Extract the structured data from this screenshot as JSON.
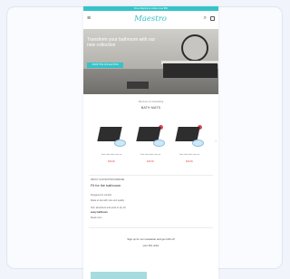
{
  "topbar": {
    "text": "Free shipping on orders over $50"
  },
  "header": {
    "brand": "Maestro",
    "menu_icon": "menu-icon",
    "search_icon": "search-icon",
    "cart_icon": "cart-icon"
  },
  "hero": {
    "headline": "Transform your bathroom with our new collection",
    "cta": "SHOP THE COLLECTION"
  },
  "bestsellers": {
    "kicker": "Discover our bestselling",
    "title": "BATH MATS",
    "products": [
      {
        "name": "Dark slate bath mat set",
        "price": "$39.00"
      },
      {
        "name": "Dark slate bath mat set",
        "price": "$39.00"
      },
      {
        "name": "Dark slate bath mat set",
        "price": "$39.00"
      }
    ]
  },
  "info": {
    "kicker": "ABOUT OUR BATHROOMWARE",
    "title": "Fit for the bathroom",
    "line1": "Designed for comfort",
    "line2": "Made to last with care and quality",
    "line3": "Soft, absorbent and quick to dry for",
    "line4": "every bathroom",
    "link": "Read more"
  },
  "footer": {
    "line1": "Sign up for our newsletter and get 10% off",
    "line2": "your first order"
  }
}
